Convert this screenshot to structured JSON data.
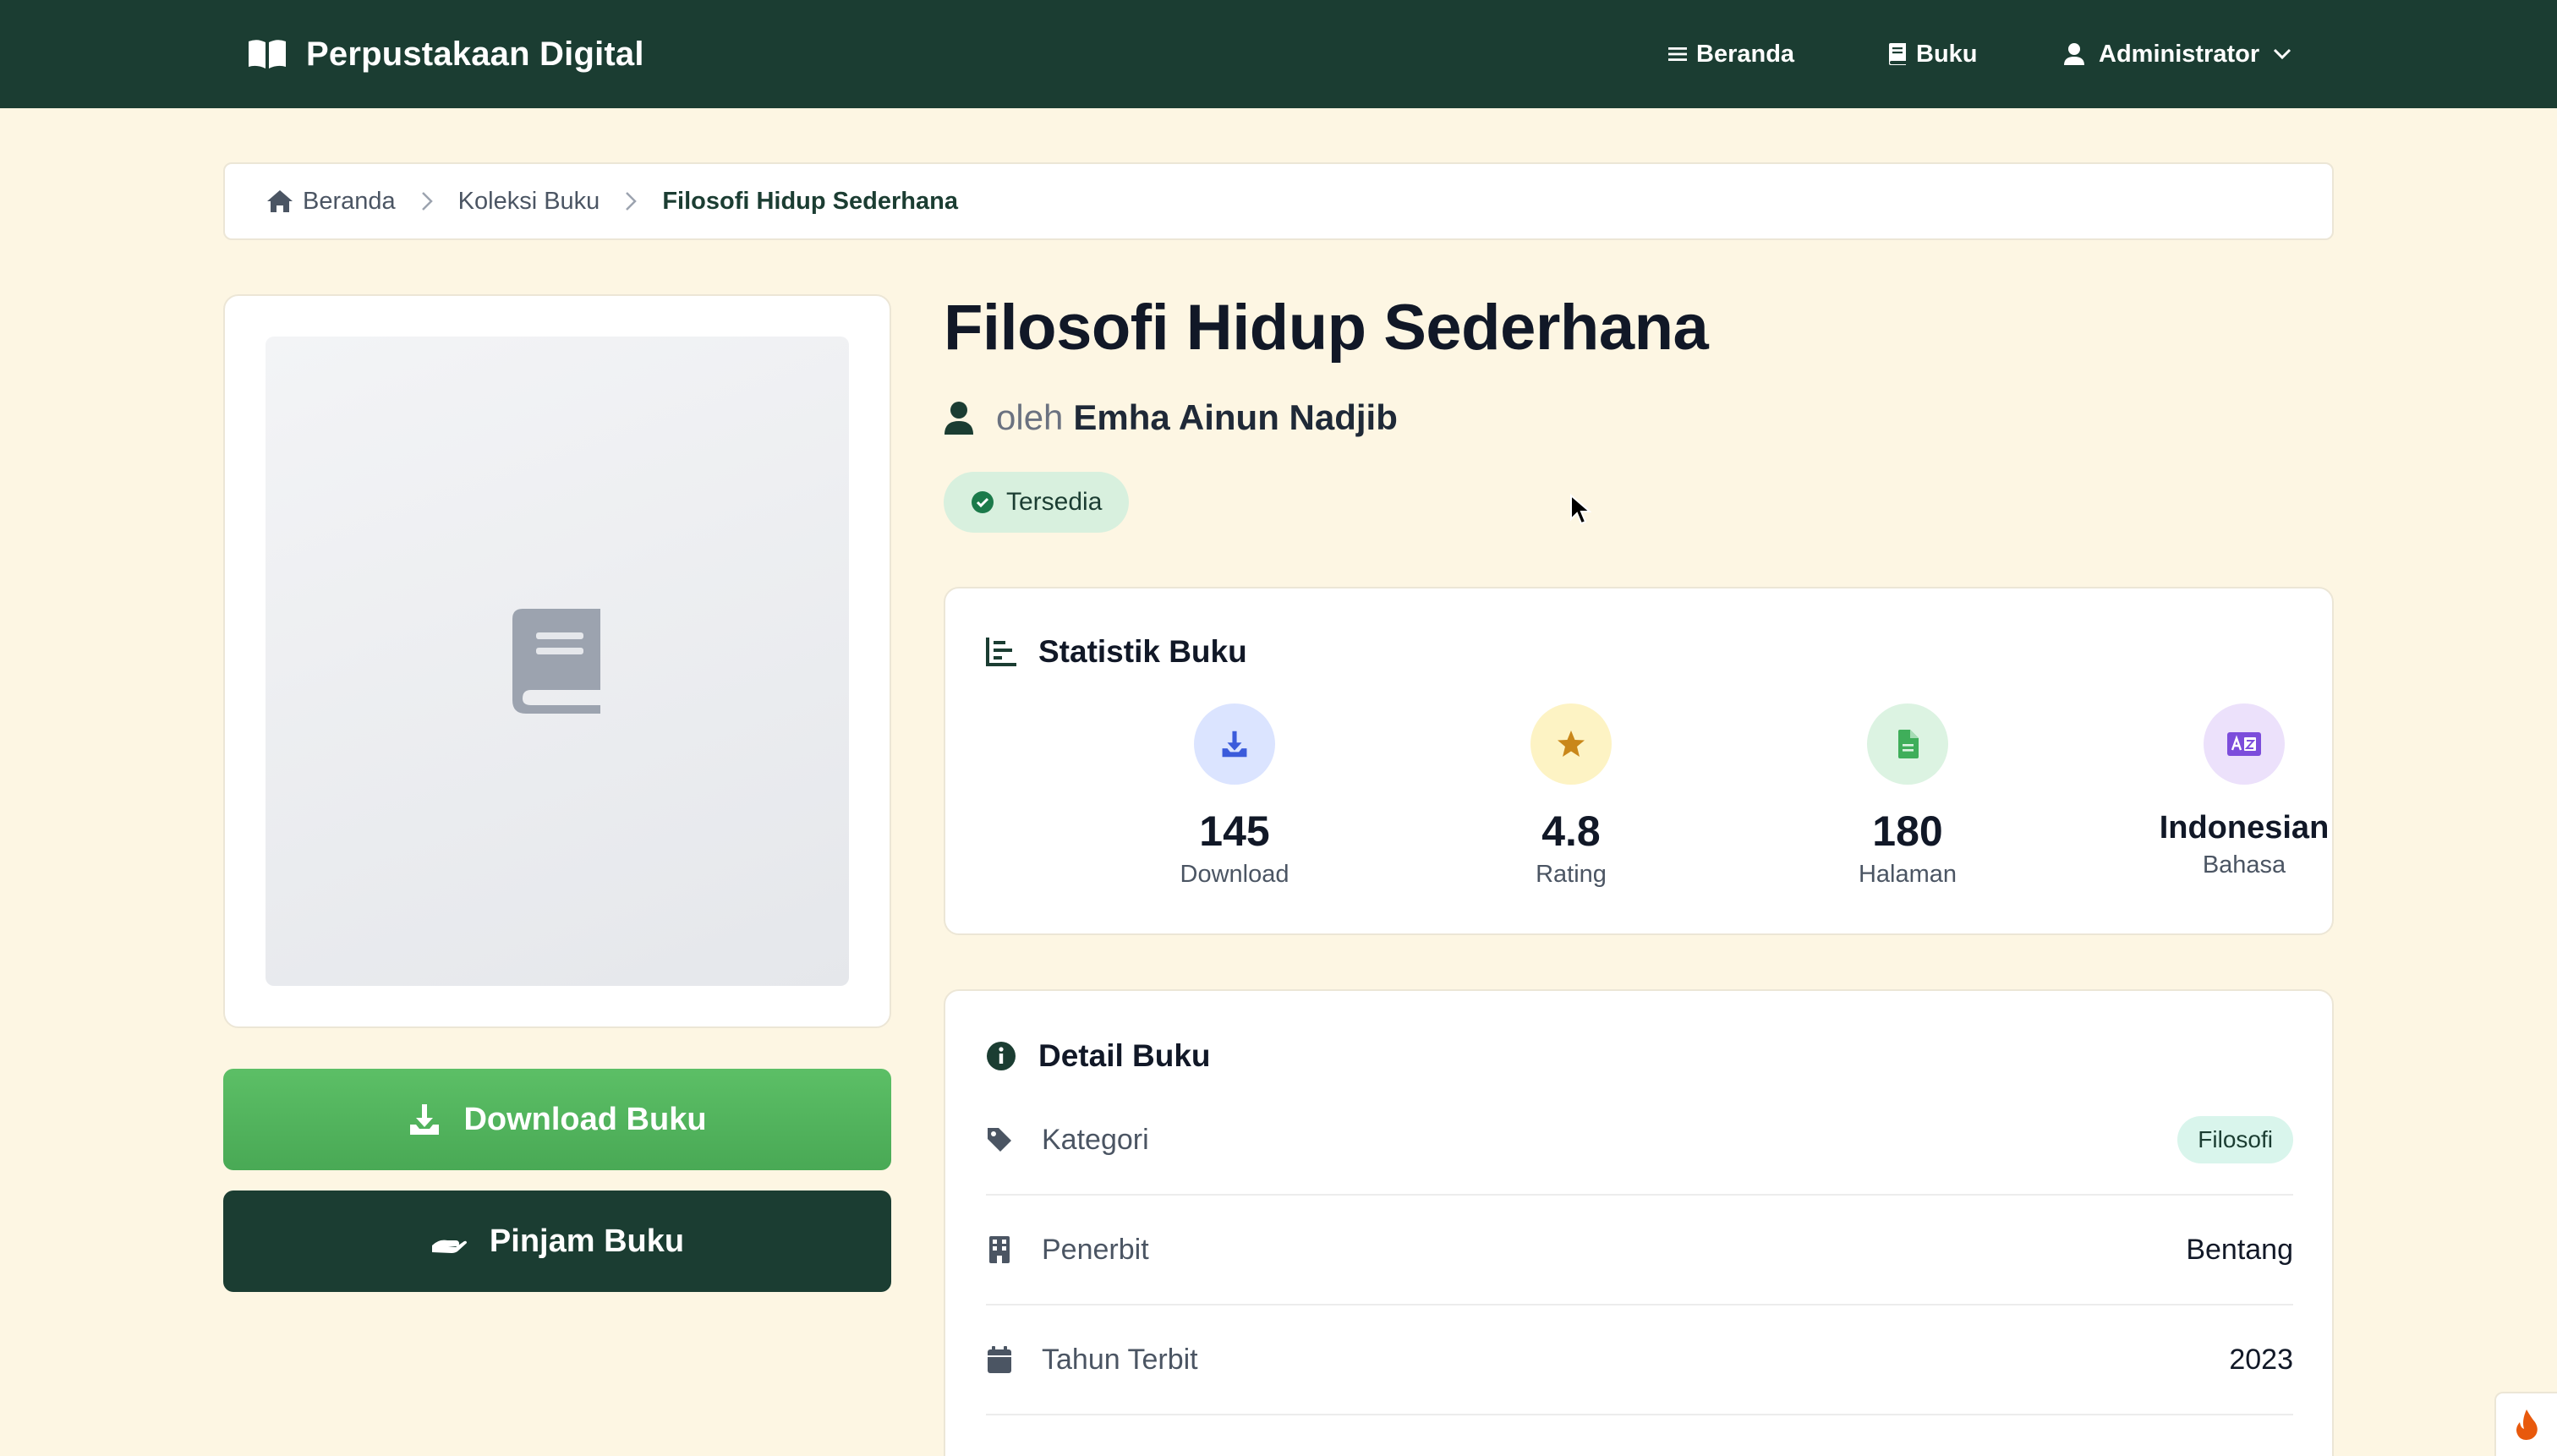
{
  "navbar": {
    "brand": "Perpustakaan Digital",
    "home_label": "Beranda",
    "books_label": "Buku",
    "admin_label": "Administrator"
  },
  "breadcrumb": {
    "home": "Beranda",
    "collection": "Koleksi Buku",
    "current": "Filosofi Hidup Sederhana"
  },
  "book": {
    "title": "Filosofi Hidup Sederhana",
    "by_prefix": "oleh",
    "author": "Emha Ainun Nadjib",
    "status": "Tersedia"
  },
  "actions": {
    "download_label": "Download Buku",
    "borrow_label": "Pinjam Buku"
  },
  "stats": {
    "header": "Statistik Buku",
    "items": [
      {
        "value": "145",
        "label": "Download",
        "icon": "download-icon",
        "color": "#3b5bdb",
        "bg": "#dbe4ff"
      },
      {
        "value": "4.8",
        "label": "Rating",
        "icon": "star-icon",
        "color": "#c9871a",
        "bg": "#fdf3c4"
      },
      {
        "value": "180",
        "label": "Halaman",
        "icon": "file-icon",
        "color": "#3fae5a",
        "bg": "#dcf3e2"
      },
      {
        "value": "Indonesian",
        "label": "Bahasa",
        "icon": "language-icon",
        "color": "#7c4ddb",
        "bg": "#ece1fb"
      }
    ]
  },
  "details": {
    "header": "Detail Buku",
    "rows": [
      {
        "label": "Kategori",
        "value": "Filosofi",
        "icon": "tag-icon"
      },
      {
        "label": "Penerbit",
        "value": "Bentang",
        "icon": "building-icon"
      },
      {
        "label": "Tahun Terbit",
        "value": "2023",
        "icon": "calendar-icon"
      }
    ]
  },
  "colors": {
    "primary": "#1b3d32",
    "accent_green": "#53b45f",
    "background": "#fdf6e3"
  }
}
